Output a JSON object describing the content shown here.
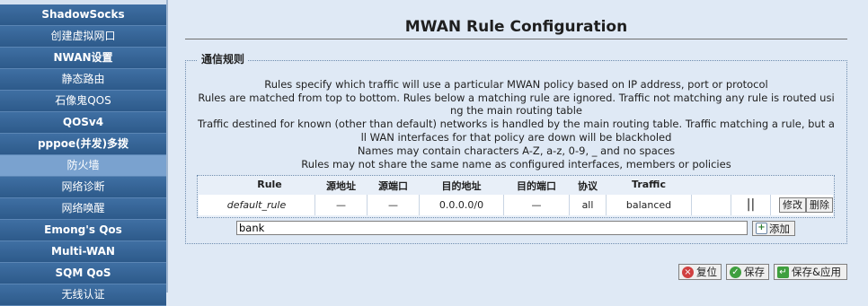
{
  "sidebar": {
    "items": [
      {
        "label": "ShadowSocks"
      },
      {
        "label": "创建虚拟网口"
      },
      {
        "label": "NWAN设置"
      },
      {
        "label": "静态路由"
      },
      {
        "label": "石像鬼QOS"
      },
      {
        "label": "QOSv4"
      },
      {
        "label": "pppoe(并发)多拨"
      },
      {
        "label": "防火墙"
      },
      {
        "label": "网络诊断"
      },
      {
        "label": "网络唤醒"
      },
      {
        "label": "Emong's Qos"
      },
      {
        "label": "Multi-WAN"
      },
      {
        "label": "SQM QoS"
      },
      {
        "label": "无线认证"
      }
    ]
  },
  "page": {
    "title": "MWAN Rule Configuration",
    "section_legend": "通信规则",
    "descriptions": [
      "Rules specify which traffic will use a particular MWAN policy based on IP address, port or protocol",
      "Rules are matched from top to bottom. Rules below a matching rule are ignored. Traffic not matching any rule is routed usi",
      "ng the main routing table",
      "Traffic destined for known (other than default) networks is handled by the main routing table. Traffic matching a rule, but a",
      "ll WAN interfaces for that policy are down will be blackholed",
      "Names may contain characters A-Z, a-z, 0-9, _ and no spaces",
      "Rules may not share the same name as configured interfaces, members or policies"
    ]
  },
  "table": {
    "headers": [
      "Rule",
      "源地址",
      "源端口",
      "目的地址",
      "目的端口",
      "协议",
      "Traffic"
    ],
    "rows": [
      {
        "rule": "default_rule",
        "src_addr": "—",
        "src_port": "—",
        "dest_addr": "0.0.0.0/0",
        "dest_port": "—",
        "proto": "all",
        "policy": "balanced",
        "order": "||"
      }
    ],
    "edit_label": "修改",
    "delete_label": "删除"
  },
  "new_rule": {
    "value": "bank",
    "add_label": "添加"
  },
  "footer": {
    "reset_label": "复位",
    "save_label": "保存",
    "save_apply_label": "保存&应用"
  },
  "icons": {
    "add": "add-icon",
    "reset": "reset-icon",
    "save": "save-icon",
    "apply": "apply-icon"
  },
  "colors": {
    "nav_bg": "#2d5a8a",
    "nav_active": "#7aa2cf",
    "page_bg": "#dfe9f5"
  }
}
